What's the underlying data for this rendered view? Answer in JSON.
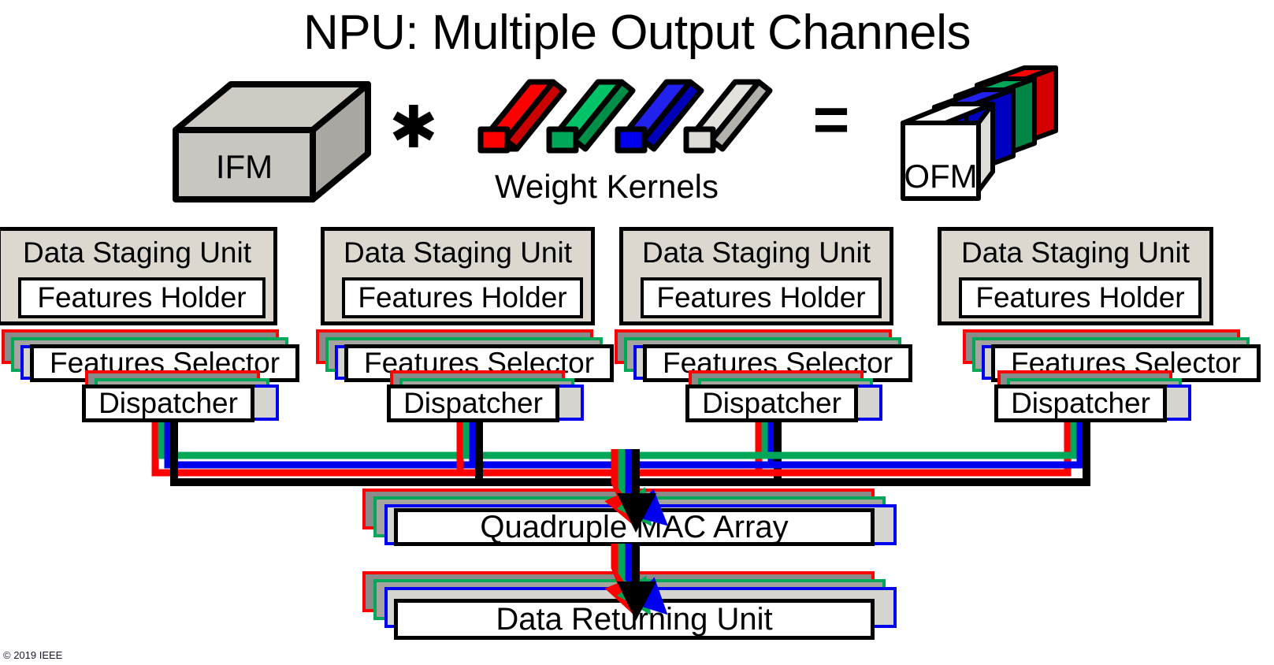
{
  "title": "NPU: Multiple Output Channels",
  "equation": {
    "ifm_label": "IFM",
    "times_symbol": "✱",
    "weight_kernels_label": "Weight Kernels",
    "equals_symbol": "=",
    "ofm_label": "OFM",
    "kernel_count": 4,
    "kernel_colors": [
      "#ff0000",
      "#00a758",
      "#0000ee",
      "#dedcd7"
    ],
    "ofm_slice_colors": [
      "#ff0000",
      "#00a758",
      "#0000ee",
      "#ffffff"
    ],
    "ifm_color": "#c8c6c0"
  },
  "staging_units": [
    {
      "title": "Data Staging Unit",
      "features_holder": "Features Holder",
      "features_selector": "Features Selector",
      "dispatcher": "Dispatcher"
    },
    {
      "title": "Data Staging Unit",
      "features_holder": "Features Holder",
      "features_selector": "Features Selector",
      "dispatcher": "Dispatcher"
    },
    {
      "title": "Data Staging Unit",
      "features_holder": "Features Holder",
      "features_selector": "Features Selector",
      "dispatcher": "Dispatcher"
    },
    {
      "title": "Data Staging Unit",
      "features_holder": "Features Holder",
      "features_selector": "Features Selector",
      "dispatcher": "Dispatcher"
    }
  ],
  "mac_array": {
    "label": "Quadruple MAC Array"
  },
  "returning_unit": {
    "label": "Data Returning Unit"
  },
  "bus": {
    "channel_colors": [
      "#ff0000",
      "#00a758",
      "#0000ee",
      "#000000"
    ],
    "channel_count": 4
  },
  "footer": {
    "copyright": "© 2019 IEEE"
  }
}
